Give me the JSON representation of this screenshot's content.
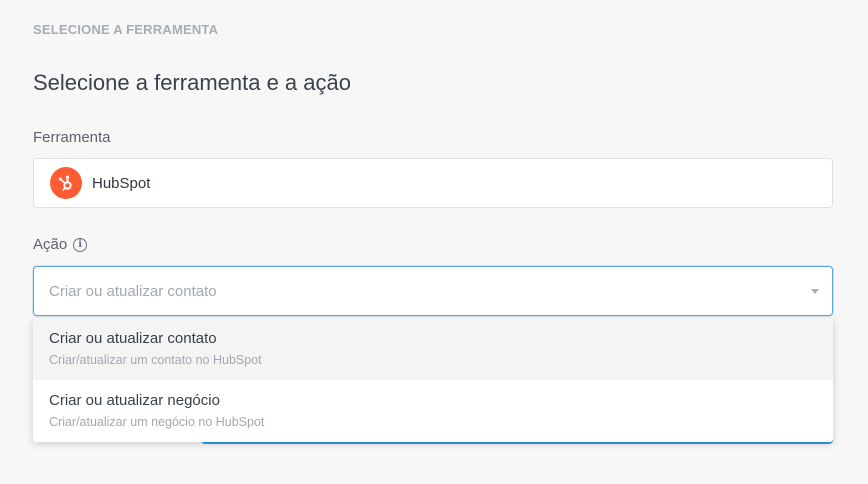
{
  "section": {
    "label": "SELECIONE A FERRAMENTA"
  },
  "title": "Selecione a ferramenta e a ação",
  "tool": {
    "label": "Ferramenta",
    "value": "HubSpot",
    "logo_color": "#ff5c35"
  },
  "action": {
    "label": "Ação",
    "info_icon": "info-icon",
    "placeholder": "Criar ou atualizar contato",
    "focus_color": "#5aa7de",
    "options": [
      {
        "title": "Criar ou atualizar contato",
        "description": "Criar/atualizar um contato no HubSpot"
      },
      {
        "title": "Criar ou atualizar negócio",
        "description": "Criar/atualizar um negócio no HubSpot"
      }
    ]
  }
}
